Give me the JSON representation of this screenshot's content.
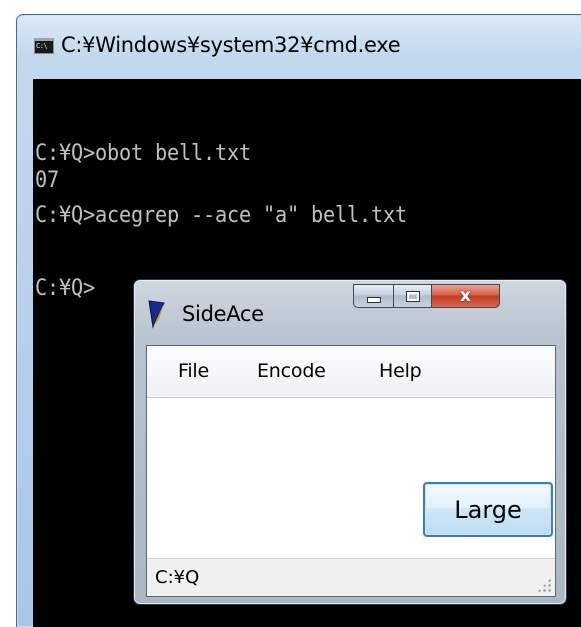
{
  "cmd": {
    "title": "C:¥Windows¥system32¥cmd.exe",
    "icon_text": "C:\\",
    "lines": [
      "C:¥Q>obot bell.txt",
      "07",
      "C:¥Q>acegrep --ace \"a\" bell.txt",
      "",
      "C:¥Q>"
    ]
  },
  "sideace": {
    "title": "SideAce",
    "menu": {
      "file": "File",
      "encode": "Encode",
      "help": "Help"
    },
    "large_button": "Large",
    "status": "C:¥Q",
    "close_glyph": "x"
  },
  "colors": {
    "console_bg": "#000000",
    "console_text": "#c0c0c0",
    "close_button": "#c23a22",
    "button_border": "#3c7fb1"
  }
}
